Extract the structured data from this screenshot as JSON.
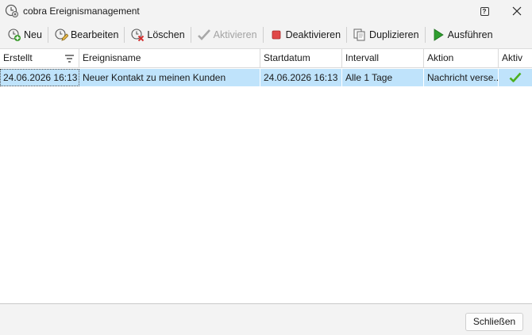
{
  "window": {
    "title": "cobra Ereignismanagement",
    "app_icon": "clock-gear-icon",
    "help_label": "?"
  },
  "toolbar": {
    "new_label": "Neu",
    "edit_label": "Bearbeiten",
    "delete_label": "Löschen",
    "activate_label": "Aktivieren",
    "deactivate_label": "Deaktivieren",
    "duplicate_label": "Duplizieren",
    "run_label": "Ausführen"
  },
  "grid": {
    "columns": {
      "created": "Erstellt",
      "name": "Ereignisname",
      "start": "Startdatum",
      "interval": "Intervall",
      "action": "Aktion",
      "active": "Aktiv"
    },
    "rows": [
      {
        "created": "24.06.2026 16:13",
        "name": "Neuer Kontakt zu meinen Kunden",
        "start": "24.06.2026 16:13",
        "interval": "Alle 1 Tage",
        "action": "Nachricht verse...",
        "active": true
      }
    ]
  },
  "footer": {
    "close_label": "Schließen"
  },
  "colors": {
    "selection": "#bfe3fb",
    "check": "#4caf1f",
    "deactivate": "#e04848",
    "run": "#2e9e2e"
  }
}
